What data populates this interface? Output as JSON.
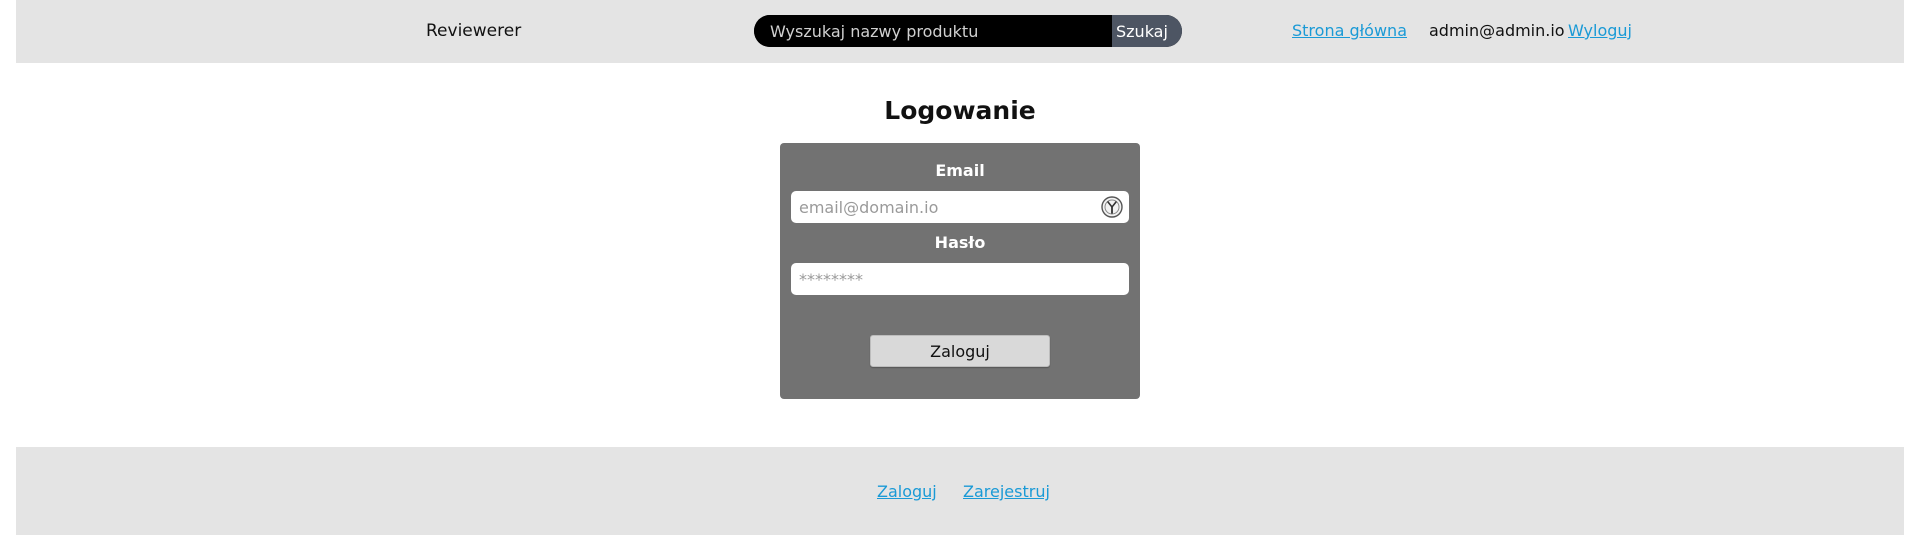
{
  "header": {
    "brand": "Reviewerer",
    "search": {
      "placeholder": "Wyszukaj nazwy produktu",
      "value": "",
      "button_label": "Szukaj"
    },
    "nav": {
      "home_label": "Strona główna",
      "user_email": "admin@admin.io",
      "logout_label": "Wyloguj"
    }
  },
  "main": {
    "title": "Logowanie",
    "form": {
      "email_label": "Email",
      "email_placeholder": "email@domain.io",
      "email_value": "",
      "email_autofill_icon": "password-manager-icon",
      "password_label": "Hasło",
      "password_placeholder": "********",
      "password_value": "",
      "submit_label": "Zaloguj"
    }
  },
  "footer": {
    "login_label": "Zaloguj",
    "register_label": "Zarejestruj"
  },
  "colors": {
    "bar_background": "#e4e4e4",
    "card_background": "#727272",
    "link": "#1a9ad6",
    "search_background": "#000000",
    "search_button": "#4d5563"
  }
}
